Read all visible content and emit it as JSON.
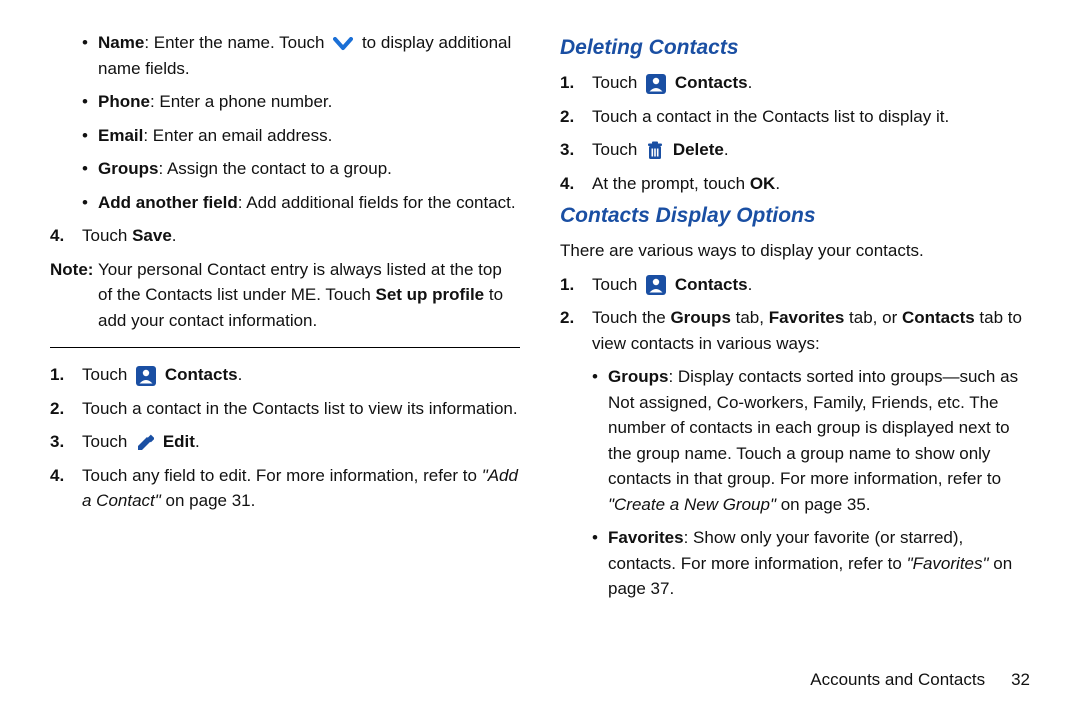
{
  "left": {
    "name_item": {
      "label": "Name",
      "text": ": Enter the name. Touch ",
      "tail": " to display additional name fields."
    },
    "phone_item": {
      "label": "Phone",
      "text": ": Enter a phone number."
    },
    "email_item": {
      "label": "Email",
      "text": ": Enter an email address."
    },
    "groups_item": {
      "label": "Groups",
      "text": ": Assign the contact to a group."
    },
    "addfield_item": {
      "label": "Add another field",
      "text": ": Add additional fields for the contact."
    },
    "step4": {
      "num": "4.",
      "pre": "Touch ",
      "bold": "Save",
      "post": "."
    },
    "note": {
      "label": "Note:",
      "pre": " Your personal Contact entry is always listed at the top of the Contacts list under ME. Touch ",
      "bold": "Set up profile",
      "post": " to add your contact information."
    },
    "edit_steps": {
      "s1": {
        "num": "1.",
        "pre": "Touch ",
        "bold": "Contacts",
        "post": "."
      },
      "s2": {
        "num": "2.",
        "text": "Touch a contact in the Contacts list to view its information."
      },
      "s3": {
        "num": "3.",
        "pre": "Touch ",
        "bold": "Edit",
        "post": "."
      },
      "s4": {
        "num": "4.",
        "pre": "Touch any field to edit. For more information, refer to ",
        "ital": "\"Add a Contact\"",
        "post": " on page 31."
      }
    }
  },
  "right": {
    "h_delete": "Deleting Contacts",
    "del": {
      "s1": {
        "num": "1.",
        "pre": "Touch ",
        "bold": "Contacts",
        "post": "."
      },
      "s2": {
        "num": "2.",
        "text": "Touch a contact in the Contacts list to display it."
      },
      "s3": {
        "num": "3.",
        "pre": "Touch ",
        "bold": "Delete",
        "post": "."
      },
      "s4": {
        "num": "4.",
        "pre": "At the prompt, touch ",
        "bold": "OK",
        "post": "."
      }
    },
    "h_display": "Contacts Display Options",
    "intro": "There are various ways to display your contacts.",
    "disp": {
      "s1": {
        "num": "1.",
        "pre": "Touch ",
        "bold": "Contacts",
        "post": "."
      },
      "s2": {
        "num": "2.",
        "a": "Touch the ",
        "b1": "Groups",
        "b": " tab, ",
        "b2": "Favorites",
        "c": " tab, or ",
        "b3": "Contacts",
        "d": " tab to view contacts in various ways:"
      }
    },
    "view": {
      "groups": {
        "label": "Groups",
        "text": ": Display contacts sorted into groups—such as Not assigned, Co-workers, Family, Friends, etc. The number of contacts in each group is displayed next to the group name. Touch a group name to show only contacts in that group. For more information, refer to ",
        "ital": "\"Create a New Group\"",
        "tail": " on page 35."
      },
      "favs": {
        "label": "Favorites",
        "text": ": Show only your favorite (or starred), contacts. For more information, refer to ",
        "ital": "\"Favorites\"",
        "tail": " on page 37."
      }
    }
  },
  "footer": {
    "section": "Accounts and Contacts",
    "page": "32"
  }
}
